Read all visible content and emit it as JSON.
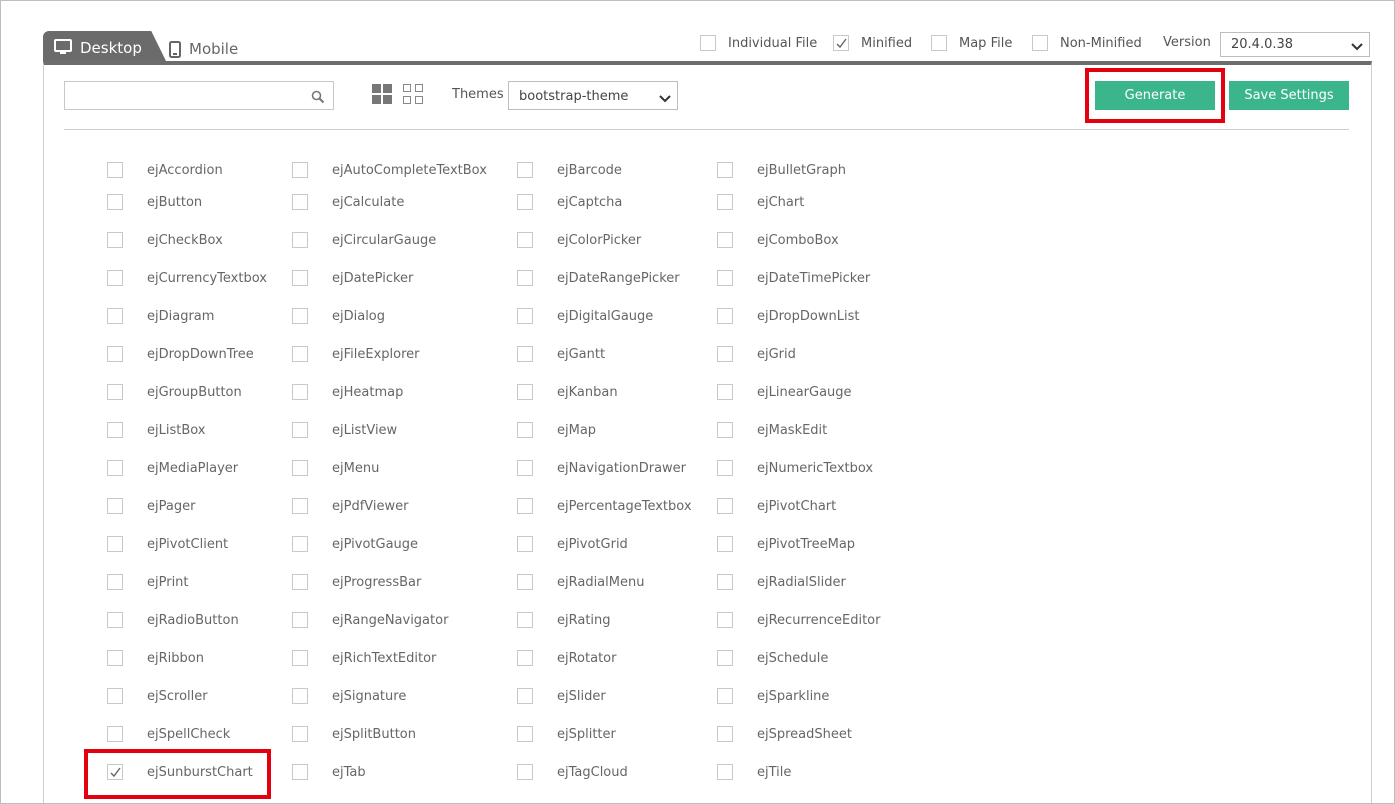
{
  "tabs": [
    {
      "label": "Desktop",
      "active": true,
      "icon": "monitor-icon"
    },
    {
      "label": "Mobile",
      "active": false,
      "icon": "mobile-icon"
    }
  ],
  "options": [
    {
      "label": "Individual File",
      "checked": false
    },
    {
      "label": "Minified",
      "checked": true
    },
    {
      "label": "Map File",
      "checked": false
    },
    {
      "label": "Non-Minified",
      "checked": false
    }
  ],
  "version": {
    "label": "Version",
    "value": "20.4.0.38"
  },
  "search": {
    "placeholder": "",
    "value": "",
    "icon": "search-icon"
  },
  "themes": {
    "label": "Themes",
    "value": "bootstrap-theme"
  },
  "buttons": {
    "generate": "Generate",
    "save_settings": "Save Settings"
  },
  "colors": {
    "accent": "#3bb58c",
    "highlight": "#e3000f",
    "tab_bg": "#6b6b6b"
  },
  "components": [
    [
      {
        "name": "ejAccordion",
        "checked": false
      },
      {
        "name": "ejAutoCompleteTextBox",
        "checked": false
      },
      {
        "name": "ejBarcode",
        "checked": false
      },
      {
        "name": "ejBulletGraph",
        "checked": false
      }
    ],
    [
      {
        "name": "ejButton",
        "checked": false
      },
      {
        "name": "ejCalculate",
        "checked": false
      },
      {
        "name": "ejCaptcha",
        "checked": false
      },
      {
        "name": "ejChart",
        "checked": false
      }
    ],
    [
      {
        "name": "ejCheckBox",
        "checked": false
      },
      {
        "name": "ejCircularGauge",
        "checked": false
      },
      {
        "name": "ejColorPicker",
        "checked": false
      },
      {
        "name": "ejComboBox",
        "checked": false
      }
    ],
    [
      {
        "name": "ejCurrencyTextbox",
        "checked": false
      },
      {
        "name": "ejDatePicker",
        "checked": false
      },
      {
        "name": "ejDateRangePicker",
        "checked": false
      },
      {
        "name": "ejDateTimePicker",
        "checked": false
      }
    ],
    [
      {
        "name": "ejDiagram",
        "checked": false
      },
      {
        "name": "ejDialog",
        "checked": false
      },
      {
        "name": "ejDigitalGauge",
        "checked": false
      },
      {
        "name": "ejDropDownList",
        "checked": false
      }
    ],
    [
      {
        "name": "ejDropDownTree",
        "checked": false
      },
      {
        "name": "ejFileExplorer",
        "checked": false
      },
      {
        "name": "ejGantt",
        "checked": false
      },
      {
        "name": "ejGrid",
        "checked": false
      }
    ],
    [
      {
        "name": "ejGroupButton",
        "checked": false
      },
      {
        "name": "ejHeatmap",
        "checked": false
      },
      {
        "name": "ejKanban",
        "checked": false
      },
      {
        "name": "ejLinearGauge",
        "checked": false
      }
    ],
    [
      {
        "name": "ejListBox",
        "checked": false
      },
      {
        "name": "ejListView",
        "checked": false
      },
      {
        "name": "ejMap",
        "checked": false
      },
      {
        "name": "ejMaskEdit",
        "checked": false
      }
    ],
    [
      {
        "name": "ejMediaPlayer",
        "checked": false
      },
      {
        "name": "ejMenu",
        "checked": false
      },
      {
        "name": "ejNavigationDrawer",
        "checked": false
      },
      {
        "name": "ejNumericTextbox",
        "checked": false
      }
    ],
    [
      {
        "name": "ejPager",
        "checked": false
      },
      {
        "name": "ejPdfViewer",
        "checked": false
      },
      {
        "name": "ejPercentageTextbox",
        "checked": false
      },
      {
        "name": "ejPivotChart",
        "checked": false
      }
    ],
    [
      {
        "name": "ejPivotClient",
        "checked": false
      },
      {
        "name": "ejPivotGauge",
        "checked": false
      },
      {
        "name": "ejPivotGrid",
        "checked": false
      },
      {
        "name": "ejPivotTreeMap",
        "checked": false
      }
    ],
    [
      {
        "name": "ejPrint",
        "checked": false
      },
      {
        "name": "ejProgressBar",
        "checked": false
      },
      {
        "name": "ejRadialMenu",
        "checked": false
      },
      {
        "name": "ejRadialSlider",
        "checked": false
      }
    ],
    [
      {
        "name": "ejRadioButton",
        "checked": false
      },
      {
        "name": "ejRangeNavigator",
        "checked": false
      },
      {
        "name": "ejRating",
        "checked": false
      },
      {
        "name": "ejRecurrenceEditor",
        "checked": false
      }
    ],
    [
      {
        "name": "ejRibbon",
        "checked": false
      },
      {
        "name": "ejRichTextEditor",
        "checked": false
      },
      {
        "name": "ejRotator",
        "checked": false
      },
      {
        "name": "ejSchedule",
        "checked": false
      }
    ],
    [
      {
        "name": "ejScroller",
        "checked": false
      },
      {
        "name": "ejSignature",
        "checked": false
      },
      {
        "name": "ejSlider",
        "checked": false
      },
      {
        "name": "ejSparkline",
        "checked": false
      }
    ],
    [
      {
        "name": "ejSpellCheck",
        "checked": false
      },
      {
        "name": "ejSplitButton",
        "checked": false
      },
      {
        "name": "ejSplitter",
        "checked": false
      },
      {
        "name": "ejSpreadSheet",
        "checked": false
      }
    ],
    [
      {
        "name": "ejSunburstChart",
        "checked": true
      },
      {
        "name": "ejTab",
        "checked": false
      },
      {
        "name": "ejTagCloud",
        "checked": false
      },
      {
        "name": "ejTile",
        "checked": false
      }
    ]
  ]
}
